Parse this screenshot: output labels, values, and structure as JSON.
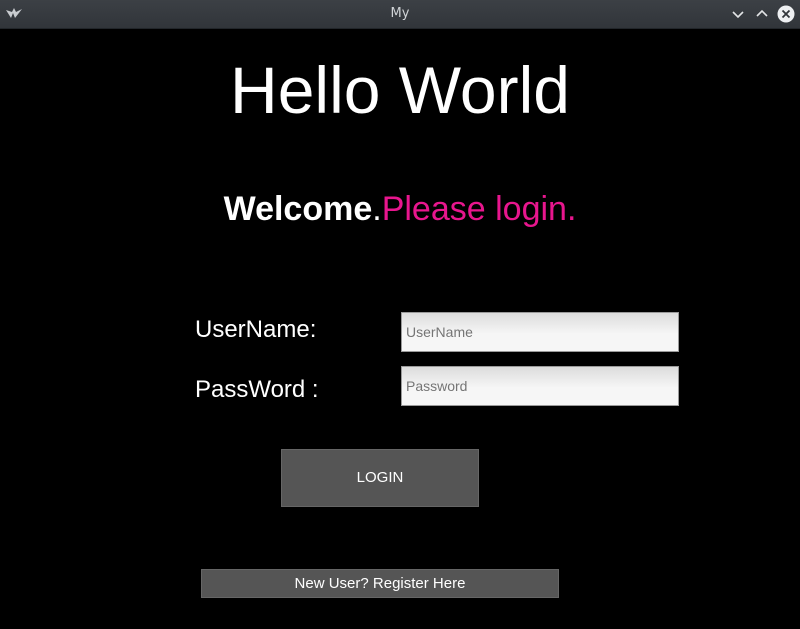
{
  "window": {
    "title": "My",
    "app_icon": "kivy-logo-icon",
    "controls": [
      "minimize-icon",
      "maximize-icon",
      "close-icon"
    ]
  },
  "main": {
    "heading": "Hello World",
    "welcome_bold": "Welcome",
    "welcome_dot": ".",
    "welcome_pink": "Please login.",
    "accent_color": "#e8168e"
  },
  "form": {
    "username_label": "UserName:",
    "username_placeholder": "UserName",
    "password_label": "PassWord :",
    "password_placeholder": "Password"
  },
  "buttons": {
    "login": "LOGIN",
    "register": "New User? Register Here"
  }
}
